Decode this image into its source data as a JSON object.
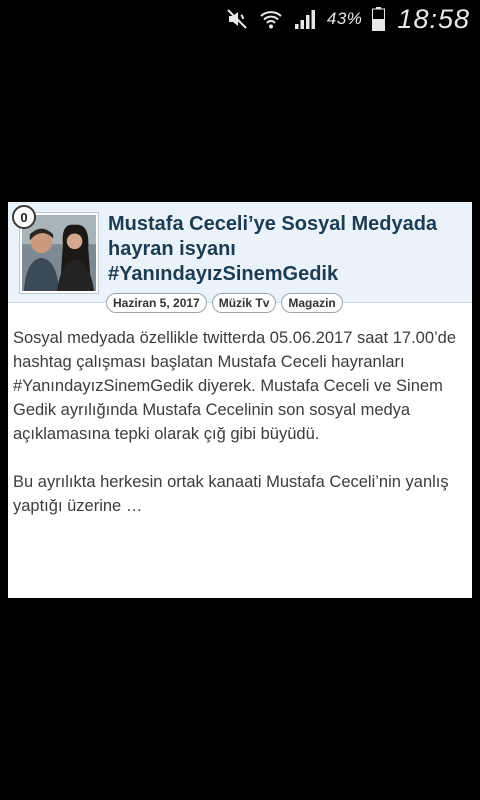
{
  "status_bar": {
    "battery_percent": "43%",
    "time": "18:58",
    "icons": [
      "mute-icon",
      "wifi-icon",
      "signal-icon",
      "battery-icon"
    ]
  },
  "article": {
    "comment_count": "0",
    "title": "Mustafa Ceceli’ye Sosyal Medyada hayran isyanı #YanındayızSinemGedik",
    "tags": [
      "Haziran 5, 2017",
      "Müzik Tv",
      "Magazin"
    ],
    "paragraphs": [
      "Sosyal medyada özellikle twitterda 05.06.2017 saat 17.00’de hashtag çalışması başlatan Mustafa Ceceli hayranları #YanındayızSinemGedik diyerek. Mustafa Ceceli ve Sinem Gedik ayrılığında Mustafa Cecelinin son sosyal medya açıklamasına tepki olarak çığ gibi büyüdü.",
      "Bu ayrılıkta herkesin ortak kanaati Mustafa Ceceli’nin yanlış yaptığı üzerine …"
    ]
  },
  "colors": {
    "header_bg": "#e9f3f9",
    "title_color": "#1d3c52",
    "text_color": "#3c3c3c"
  }
}
